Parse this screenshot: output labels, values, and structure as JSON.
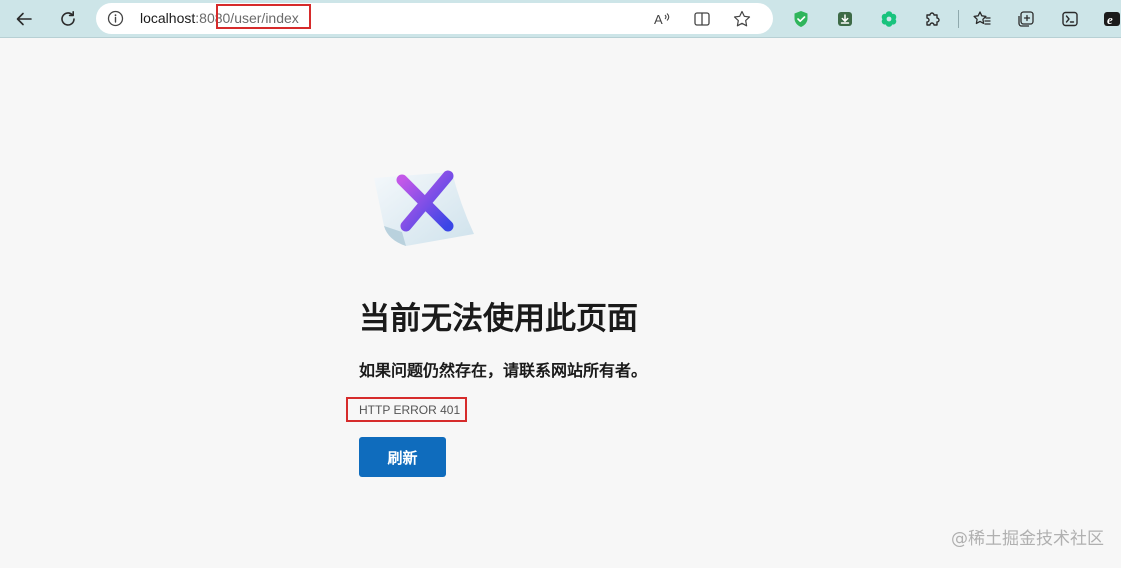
{
  "browser": {
    "address_bar": {
      "url_host": "localhost",
      "url_rest": ":8080/user/index"
    },
    "icons": [
      "back-arrow-icon",
      "refresh-icon",
      "info-icon",
      "read-aloud-icon",
      "split-screen-icon",
      "favorite-star-icon",
      "shield-extension-icon",
      "download-extension-icon",
      "chatgpt-extension-icon",
      "extensions-puzzle-icon",
      "favorites-icon",
      "collections-icon",
      "screenshot-icon",
      "edge-icon"
    ],
    "colors": {
      "toolbar_bg": "#cde5e8",
      "highlight_red": "#d62b2b"
    }
  },
  "error_page": {
    "title": "当前无法使用此页面",
    "subtitle": "如果问题仍然存在，请联系网站所有者。",
    "error_code": "HTTP ERROR 401",
    "refresh_label": "刷新",
    "colors": {
      "button_bg": "#0f6cbd",
      "x_gradient_start": "#c258e8",
      "x_gradient_end": "#3a46e6"
    }
  },
  "watermark": "@稀土掘金技术社区"
}
